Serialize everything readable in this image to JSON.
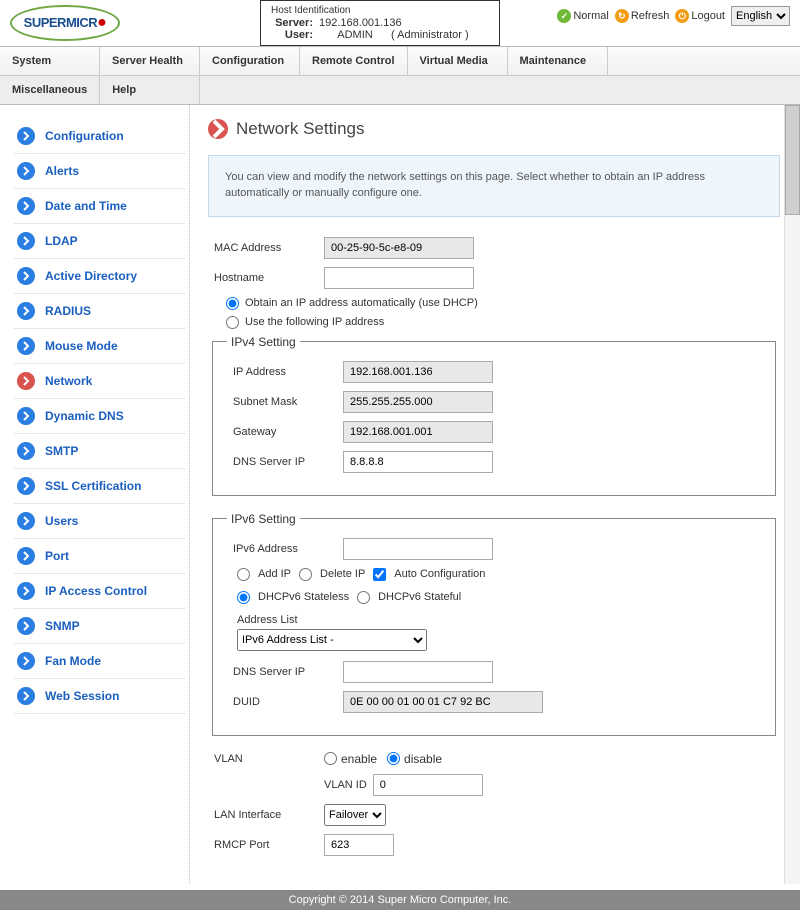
{
  "brand": "SUPERMICR",
  "host": {
    "legend": "Host Identification",
    "server_label": "Server:",
    "server": "192.168.001.136",
    "user_label": "User:",
    "user": "ADMIN",
    "role": "( Administrator )"
  },
  "toplinks": {
    "normal": "Normal",
    "refresh": "Refresh",
    "logout": "Logout",
    "lang": "English"
  },
  "nav1": [
    "System",
    "Server Health",
    "Configuration",
    "Remote Control",
    "Virtual Media",
    "Maintenance"
  ],
  "nav2": [
    "Miscellaneous",
    "Help"
  ],
  "sidebar": [
    {
      "label": "Configuration"
    },
    {
      "label": "Alerts"
    },
    {
      "label": "Date and Time"
    },
    {
      "label": "LDAP"
    },
    {
      "label": "Active Directory"
    },
    {
      "label": "RADIUS"
    },
    {
      "label": "Mouse Mode"
    },
    {
      "label": "Network",
      "active": true
    },
    {
      "label": "Dynamic DNS"
    },
    {
      "label": "SMTP"
    },
    {
      "label": "SSL Certification"
    },
    {
      "label": "Users"
    },
    {
      "label": "Port"
    },
    {
      "label": "IP Access Control"
    },
    {
      "label": "SNMP"
    },
    {
      "label": "Fan Mode"
    },
    {
      "label": "Web Session"
    }
  ],
  "page": {
    "title": "Network Settings",
    "info": "You can view and modify the network settings on this page. Select whether to obtain an IP address automatically or manually configure one.",
    "mac_label": "MAC Address",
    "mac": "00-25-90-5c-e8-09",
    "hostname_label": "Hostname",
    "hostname": "",
    "dhcp_auto": "Obtain an IP address automatically (use DHCP)",
    "dhcp_manual": "Use the following IP address",
    "ipv4_legend": "IPv4 Setting",
    "ip_label": "IP Address",
    "ip": "192.168.001.136",
    "subnet_label": "Subnet Mask",
    "subnet": "255.255.255.000",
    "gateway_label": "Gateway",
    "gateway": "192.168.001.001",
    "dns_label": "DNS Server IP",
    "dns": "8.8.8.8",
    "ipv6_legend": "IPv6 Setting",
    "ipv6addr_label": "IPv6 Address",
    "ipv6addr": "",
    "addip": "Add IP",
    "delip": "Delete IP",
    "autoconf": "Auto Configuration",
    "stateless": "DHCPv6 Stateless",
    "stateful": "DHCPv6 Stateful",
    "addrlist_label": "Address List",
    "addrlist": "IPv6 Address List -",
    "dns6_label": "DNS Server IP",
    "dns6": "",
    "duid_label": "DUID",
    "duid": "0E 00 00 01 00 01 C7 92 BC",
    "vlan_label": "VLAN",
    "enable": "enable",
    "disable": "disable",
    "vlanid_label": "VLAN ID",
    "vlanid": "0",
    "lanif_label": "LAN Interface",
    "lanif": "Failover",
    "rmcp_label": "RMCP Port",
    "rmcp": "623"
  },
  "footer": "Copyright © 2014 Super Micro Computer, Inc."
}
